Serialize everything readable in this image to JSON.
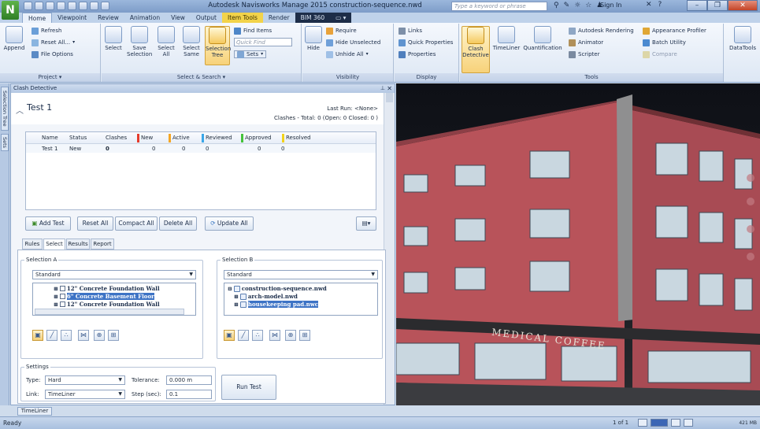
{
  "titlebar": {
    "app_letter": "N",
    "title": "Autodesk Navisworks Manage 2015   construction-sequence.nwd",
    "search_placeholder": "Type a keyword or phrase",
    "sign_in": "Sign In"
  },
  "tabs": [
    "Home",
    "Viewpoint",
    "Review",
    "Animation",
    "View",
    "Output",
    "Item Tools",
    "Render",
    "BIM 360"
  ],
  "ribbon": {
    "project": {
      "label": "Project",
      "append": "Append",
      "refresh": "Refresh",
      "reset_all": "Reset All...",
      "file_options": "File Options"
    },
    "select_search": {
      "label": "Select & Search",
      "select": "Select",
      "save_selection": "Save Selection",
      "select_all": "Select All",
      "select_same": "Select Same",
      "selection_tree": "Selection Tree",
      "find_items": "Find Items",
      "quick_find_placeholder": "Quick Find",
      "sets": "Sets"
    },
    "visibility": {
      "label": "Visibility",
      "hide": "Hide",
      "require": "Require",
      "hide_unselected": "Hide Unselected",
      "unhide_all": "Unhide All"
    },
    "display": {
      "label": "Display",
      "links": "Links",
      "quick_properties": "Quick Properties",
      "properties": "Properties"
    },
    "tools": {
      "label": "Tools",
      "clash_detective": "Clash Detective",
      "timeliner": "TimeLiner",
      "quantification": "Quantification",
      "autodesk_rendering": "Autodesk Rendering",
      "animator": "Animator",
      "scripter": "Scripter",
      "appearance_profiler": "Appearance Profiler",
      "batch_utility": "Batch Utility",
      "compare": "Compare",
      "datatools": "DataTools"
    }
  },
  "side_tabs": [
    "Selection Tree",
    "Sets"
  ],
  "pane": {
    "title": "Clash Detective",
    "test_name": "Test 1",
    "last_run": "Last Run:  <None>",
    "summary": "Clashes - Total: 0  (Open: 0  Closed: 0 )",
    "columns": [
      {
        "label": "Name",
        "color": null
      },
      {
        "label": "Status",
        "color": null
      },
      {
        "label": "Clashes",
        "color": null
      },
      {
        "label": "New",
        "color": "#e53b2c"
      },
      {
        "label": "Active",
        "color": "#f5a623"
      },
      {
        "label": "Reviewed",
        "color": "#3aa7e8"
      },
      {
        "label": "Approved",
        "color": "#44c33b"
      },
      {
        "label": "Resolved",
        "color": "#f2d31b"
      }
    ],
    "rows": [
      [
        "Test 1",
        "New",
        "0",
        "0",
        "0",
        "0",
        "0",
        "0"
      ]
    ],
    "buttons": {
      "add_test": "Add Test",
      "reset_all": "Reset All",
      "compact_all": "Compact All",
      "delete_all": "Delete All",
      "update_all": "Update All"
    },
    "subtabs": [
      "Rules",
      "Select",
      "Results",
      "Report"
    ],
    "active_subtab": "Select",
    "selection_a": {
      "label": "Selection A",
      "dropdown": "Standard",
      "items": [
        "12\" Concrete Foundation Wall",
        "6\" Concrete Basement Floor",
        "12\" Concrete Foundation Wall"
      ],
      "selected_index": 1
    },
    "selection_b": {
      "label": "Selection B",
      "dropdown": "Standard",
      "items": [
        "construction-sequence.nwd",
        "arch-model.nwd",
        "housekeeping pad.nwc"
      ],
      "selected_index": 2
    },
    "settings": {
      "label": "Settings",
      "type_label": "Type:",
      "type_value": "Hard",
      "tolerance_label": "Tolerance:",
      "tolerance_value": "0.000 m",
      "link_label": "Link:",
      "link_value": "TimeLiner",
      "step_label": "Step (sec):",
      "step_value": "0.1"
    },
    "run_test": "Run Test"
  },
  "viewport": {
    "sign_text": "MEDICAL  COFFEE"
  },
  "bottom": {
    "timeliner_tab": "TimeLiner",
    "status": "Ready",
    "page": "1 of 1",
    "memory": "421 MB"
  }
}
